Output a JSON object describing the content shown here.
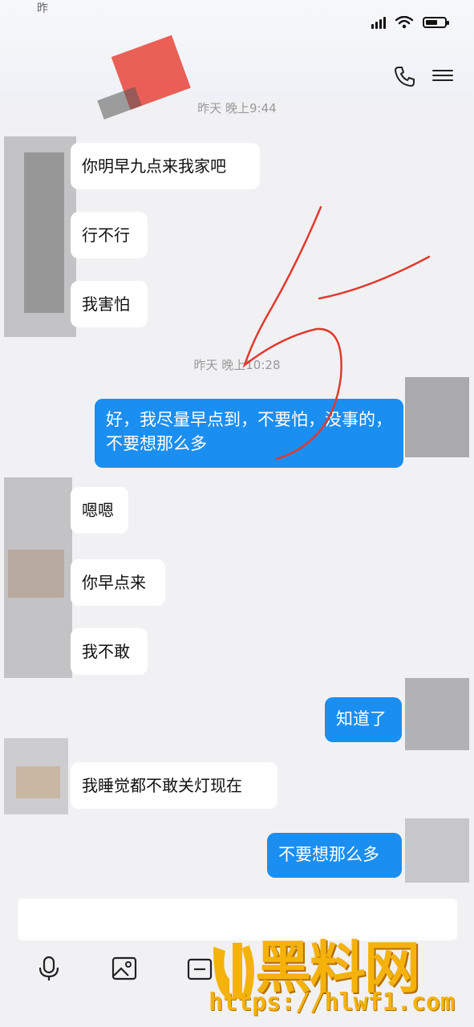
{
  "status_bar": {
    "time": "昨"
  },
  "messages": [
    {
      "type": "time",
      "text": "昨天 晚上9:44"
    },
    {
      "type": "left",
      "text": "你明早九点来我家吧"
    },
    {
      "type": "left",
      "text": "行不行"
    },
    {
      "type": "left",
      "text": "我害怕"
    },
    {
      "type": "time",
      "text": "昨天 晚上10:28"
    },
    {
      "type": "right",
      "text": "好，我尽量早点到，不要怕，没事的，不要想那么多"
    },
    {
      "type": "left",
      "text": "嗯嗯"
    },
    {
      "type": "left",
      "text": "你早点来"
    },
    {
      "type": "left",
      "text": "我不敢"
    },
    {
      "type": "right",
      "text": "知道了"
    },
    {
      "type": "left",
      "text": "我睡觉都不敢关灯现在"
    },
    {
      "type": "right",
      "text": "不要想那么多"
    }
  ],
  "watermark": {
    "brand": "黑料网",
    "url": "https://hlwf1.com"
  },
  "colors": {
    "sent_bubble": "#1b8ef1",
    "received_bubble": "#ffffff",
    "annotation": "#e03a2f",
    "watermark": "#f5b20b"
  },
  "icons": [
    "signal-icon",
    "wifi-icon",
    "battery-icon",
    "phone-icon",
    "menu-icon",
    "microphone-icon",
    "image-icon",
    "camera-icon"
  ]
}
